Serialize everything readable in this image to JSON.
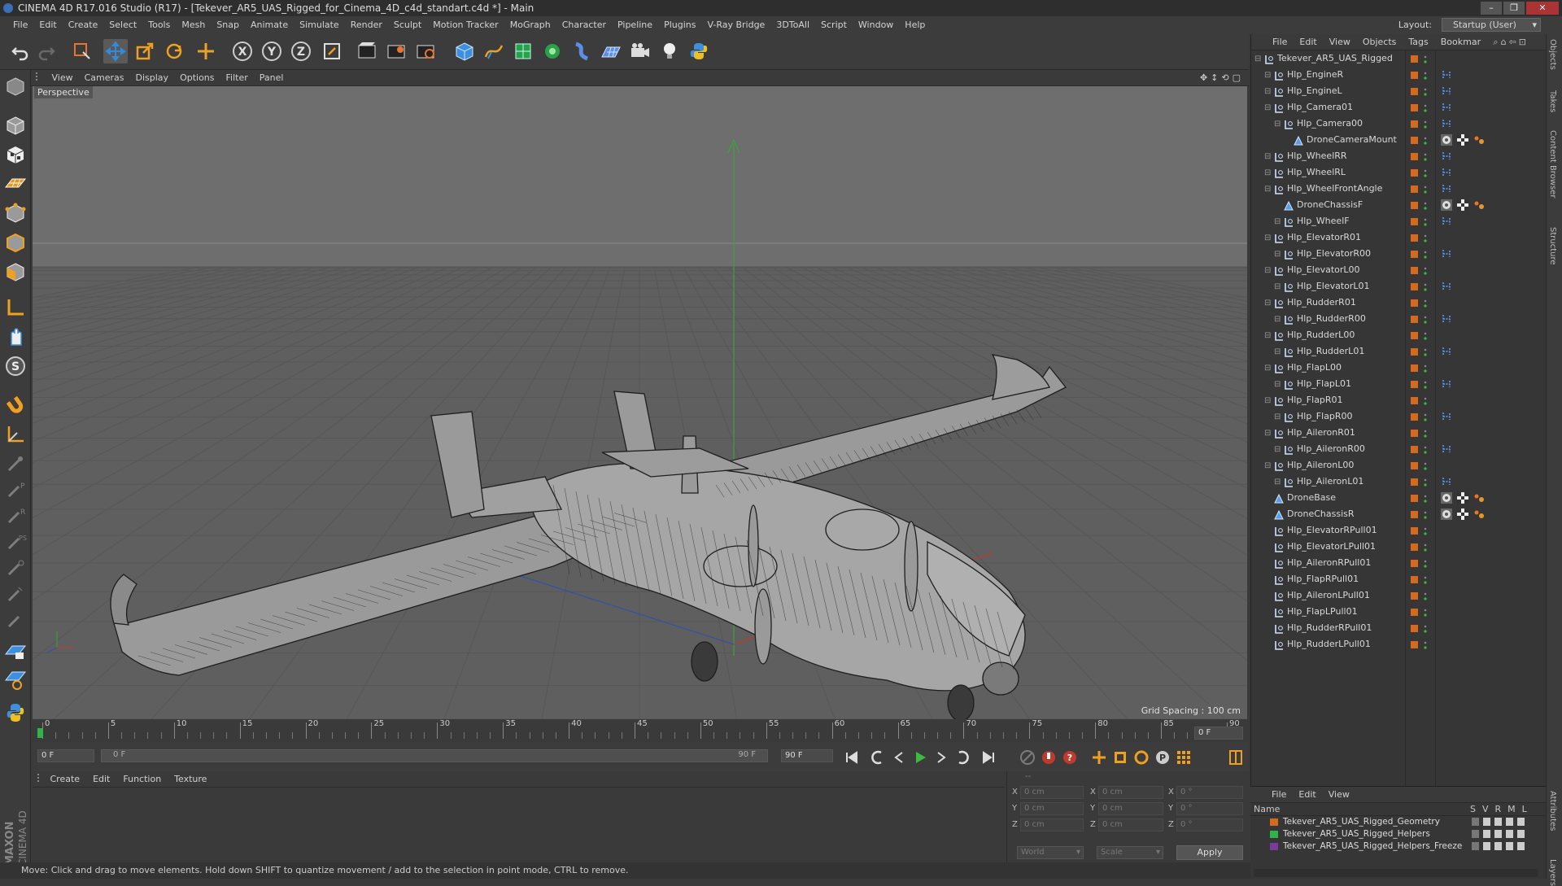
{
  "window": {
    "title": "CINEMA 4D R17.016 Studio (R17) - [Tekever_AR5_UAS_Rigged_for_Cinema_4D_c4d_standart.c4d *] - Main",
    "controls": [
      "–",
      "❐",
      "✕"
    ]
  },
  "menubar": {
    "items": [
      "File",
      "Edit",
      "Create",
      "Select",
      "Tools",
      "Mesh",
      "Snap",
      "Animate",
      "Simulate",
      "Render",
      "Sculpt",
      "Motion Tracker",
      "MoGraph",
      "Character",
      "Pipeline",
      "Plugins",
      "V-Ray Bridge",
      "3DToAll",
      "Script",
      "Window",
      "Help"
    ],
    "layout_label": "Layout:",
    "layout_value": "Startup (User)"
  },
  "toolbar": {
    "icons": [
      "undo-icon",
      "redo-icon",
      "live-selection-icon",
      "move-icon",
      "scale-icon",
      "rotate-icon",
      "last-tool-icon",
      "x-axis-icon",
      "y-axis-icon",
      "z-axis-icon",
      "world-coordinates-icon",
      "render-view-icon",
      "render-picture-viewer-icon",
      "render-settings-icon",
      "cube-icon",
      "pen-icon",
      "subdivision-icon",
      "cloner-icon",
      "deformer-icon",
      "floor-icon",
      "camera-icon",
      "light-icon",
      "python-icon"
    ],
    "axis_labels": [
      "X",
      "Y",
      "Z"
    ]
  },
  "viewport": {
    "menu": [
      "View",
      "Cameras",
      "Display",
      "Options",
      "Filter",
      "Panel"
    ],
    "label": "Perspective",
    "grid_spacing": "Grid Spacing : 100 cm"
  },
  "timeline": {
    "ticks": [
      "0",
      "5",
      "10",
      "15",
      "20",
      "25",
      "30",
      "35",
      "40",
      "45",
      "50",
      "55",
      "60",
      "65",
      "70",
      "75",
      "80",
      "85",
      "90"
    ],
    "current_frame": "0 F",
    "start_frame": "0 F",
    "range_start": "0 F",
    "range_end": "90 F",
    "end_frame": "90 F"
  },
  "material_manager": {
    "menu": [
      "Create",
      "Edit",
      "Function",
      "Texture"
    ]
  },
  "coordinates": {
    "header": "--",
    "rows": [
      {
        "axis": "X",
        "pos": "0 cm",
        "size_axis": "X",
        "size": "0 cm",
        "rot_axis": "X",
        "rot": "0 °"
      },
      {
        "axis": "Y",
        "pos": "0 cm",
        "size_axis": "Y",
        "size": "0 cm",
        "rot_axis": "Y",
        "rot": "0 °"
      },
      {
        "axis": "Z",
        "pos": "0 cm",
        "size_axis": "Z",
        "size": "0 cm",
        "rot_axis": "Z",
        "rot": "0 °"
      }
    ],
    "mode": "World",
    "transform": "Scale",
    "apply": "Apply"
  },
  "object_manager": {
    "menu": [
      "File",
      "Edit",
      "View",
      "Objects",
      "Tags",
      "Bookmar"
    ],
    "objects": [
      {
        "name": "Tekever_AR5_UAS_Rigged",
        "depth": 0,
        "type": "null",
        "tags": []
      },
      {
        "name": "Hlp_EngineR",
        "depth": 1,
        "type": "null",
        "tags": [
          "ik"
        ]
      },
      {
        "name": "Hlp_EngineL",
        "depth": 1,
        "type": "null",
        "tags": [
          "ik"
        ]
      },
      {
        "name": "Hlp_Camera01",
        "depth": 1,
        "type": "null",
        "tags": [
          "ik"
        ]
      },
      {
        "name": "Hlp_Camera00",
        "depth": 2,
        "type": "null",
        "tags": [
          "ik"
        ]
      },
      {
        "name": "DroneCameraMount",
        "depth": 3,
        "type": "mesh",
        "tags": [
          "phong",
          "texture",
          "material"
        ]
      },
      {
        "name": "Hlp_WheelRR",
        "depth": 1,
        "type": "null",
        "tags": [
          "ik"
        ]
      },
      {
        "name": "Hlp_WheelRL",
        "depth": 1,
        "type": "null",
        "tags": [
          "ik"
        ]
      },
      {
        "name": "Hlp_WheelFrontAngle",
        "depth": 1,
        "type": "null",
        "tags": [
          "ik"
        ]
      },
      {
        "name": "DroneChassisF",
        "depth": 2,
        "type": "mesh",
        "tags": [
          "phong",
          "texture",
          "material"
        ]
      },
      {
        "name": "Hlp_WheelF",
        "depth": 2,
        "type": "null",
        "tags": [
          "ik"
        ]
      },
      {
        "name": "Hlp_ElevatorR01",
        "depth": 1,
        "type": "null",
        "tags": []
      },
      {
        "name": "Hlp_ElevatorR00",
        "depth": 2,
        "type": "null",
        "tags": [
          "ik"
        ]
      },
      {
        "name": "Hlp_ElevatorL00",
        "depth": 1,
        "type": "null",
        "tags": []
      },
      {
        "name": "Hlp_ElevatorL01",
        "depth": 2,
        "type": "null",
        "tags": [
          "ik"
        ]
      },
      {
        "name": "Hlp_RudderR01",
        "depth": 1,
        "type": "null",
        "tags": []
      },
      {
        "name": "Hlp_RudderR00",
        "depth": 2,
        "type": "null",
        "tags": [
          "ik"
        ]
      },
      {
        "name": "Hlp_RudderL00",
        "depth": 1,
        "type": "null",
        "tags": []
      },
      {
        "name": "Hlp_RudderL01",
        "depth": 2,
        "type": "null",
        "tags": [
          "ik"
        ]
      },
      {
        "name": "Hlp_FlapL00",
        "depth": 1,
        "type": "null",
        "tags": []
      },
      {
        "name": "Hlp_FlapL01",
        "depth": 2,
        "type": "null",
        "tags": [
          "ik"
        ]
      },
      {
        "name": "Hlp_FlapR01",
        "depth": 1,
        "type": "null",
        "tags": []
      },
      {
        "name": "Hlp_FlapR00",
        "depth": 2,
        "type": "null",
        "tags": [
          "ik"
        ]
      },
      {
        "name": "Hlp_AileronR01",
        "depth": 1,
        "type": "null",
        "tags": []
      },
      {
        "name": "Hlp_AileronR00",
        "depth": 2,
        "type": "null",
        "tags": [
          "ik"
        ]
      },
      {
        "name": "Hlp_AileronL00",
        "depth": 1,
        "type": "null",
        "tags": []
      },
      {
        "name": "Hlp_AileronL01",
        "depth": 2,
        "type": "null",
        "tags": [
          "ik"
        ]
      },
      {
        "name": "DroneBase",
        "depth": 1,
        "type": "mesh",
        "tags": [
          "phong",
          "texture",
          "material"
        ]
      },
      {
        "name": "DroneChassisR",
        "depth": 1,
        "type": "mesh",
        "tags": [
          "phong",
          "texture",
          "material"
        ]
      },
      {
        "name": "Hlp_ElevatorRPull01",
        "depth": 1,
        "type": "null",
        "tags": []
      },
      {
        "name": "Hlp_ElevatorLPull01",
        "depth": 1,
        "type": "null",
        "tags": []
      },
      {
        "name": "Hlp_AileronRPull01",
        "depth": 1,
        "type": "null",
        "tags": []
      },
      {
        "name": "Hlp_FlapRPull01",
        "depth": 1,
        "type": "null",
        "tags": []
      },
      {
        "name": "Hlp_AileronLPull01",
        "depth": 1,
        "type": "null",
        "tags": []
      },
      {
        "name": "Hlp_FlapLPull01",
        "depth": 1,
        "type": "null",
        "tags": []
      },
      {
        "name": "Hlp_RudderRPull01",
        "depth": 1,
        "type": "null",
        "tags": []
      },
      {
        "name": "Hlp_RudderLPull01",
        "depth": 1,
        "type": "null",
        "tags": []
      }
    ]
  },
  "layer_manager": {
    "menu": [
      "File",
      "Edit",
      "View"
    ],
    "header_name": "Name",
    "header_cols": [
      "S",
      "V",
      "R",
      "M",
      "L"
    ],
    "layers": [
      {
        "name": "Tekever_AR5_UAS_Rigged_Geometry",
        "color": "#d36a1e"
      },
      {
        "name": "Tekever_AR5_UAS_Rigged_Helpers",
        "color": "#2fb34a"
      },
      {
        "name": "Tekever_AR5_UAS_Rigged_Helpers_Freeze",
        "color": "#7a3b9a"
      }
    ]
  },
  "right_tabs": [
    "Objects",
    "Takes",
    "Content Browser",
    "Structure"
  ],
  "right_tabs_bottom": [
    "Attributes",
    "Layers"
  ],
  "status": "Move: Click and drag to move elements. Hold down SHIFT to quantize movement / add to the selection in point mode, CTRL to remove.",
  "logo": {
    "line1": "MAXON",
    "line2": "CINEMA 4D"
  },
  "colors": {
    "accent": "#d36a1e",
    "green": "#2fb34a",
    "selection": "#3b6fb6"
  }
}
